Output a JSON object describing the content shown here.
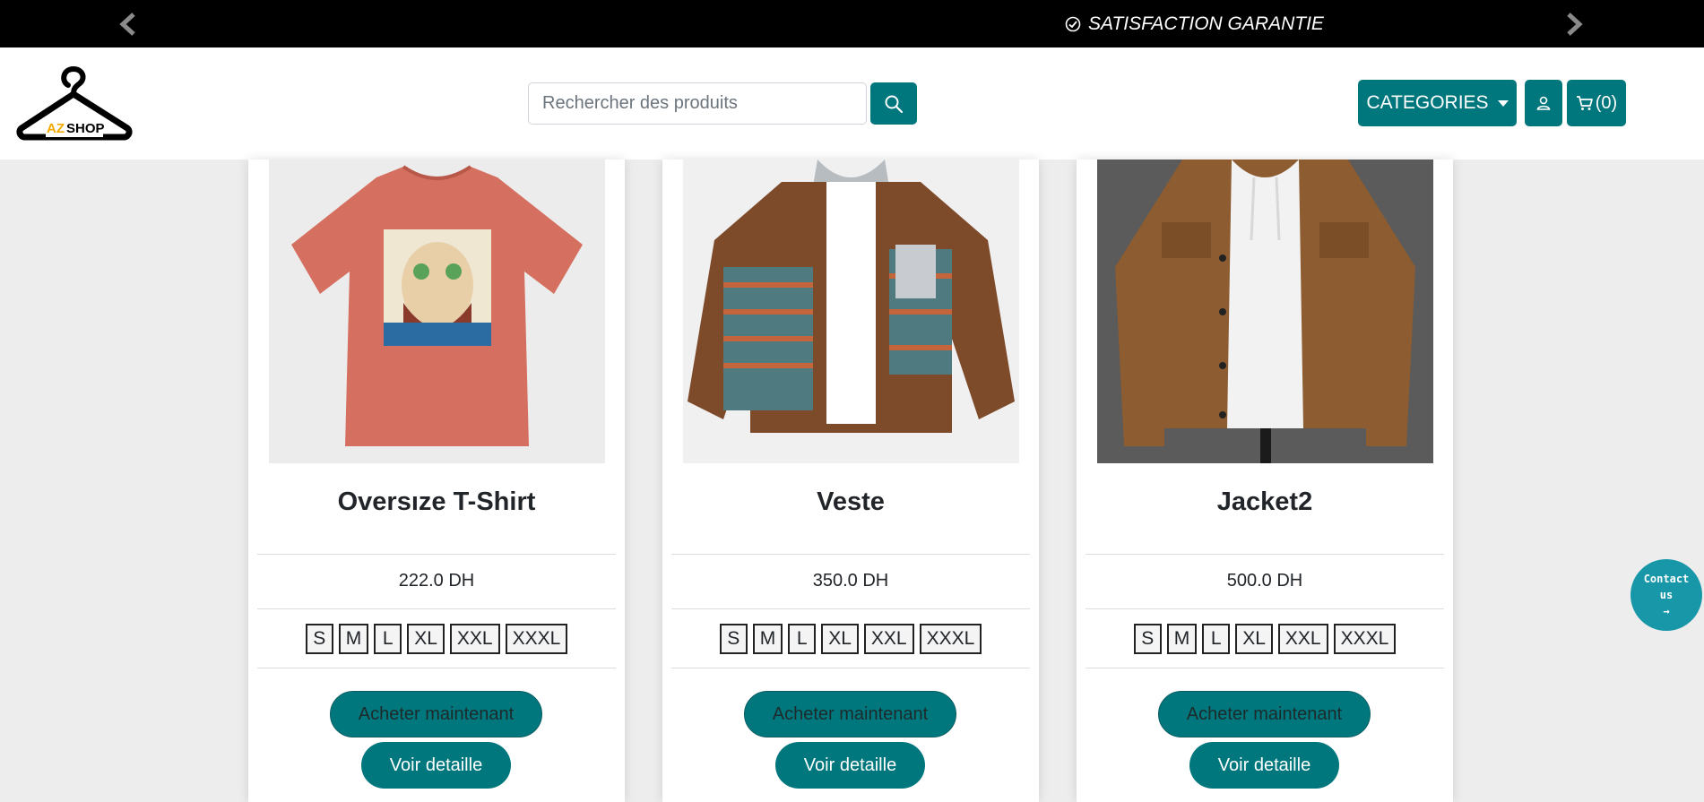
{
  "topbar": {
    "promo_text": "SATISFACTION GARANTIE",
    "icons": [
      "chevron-left-icon",
      "check-circle-icon",
      "chevron-right-icon"
    ]
  },
  "header": {
    "logo": {
      "brand": "AZ SHOP"
    },
    "search": {
      "placeholder": "Rechercher des produits",
      "value": ""
    },
    "categories_label": "CATEGORIES",
    "cart_label": "(0)",
    "icons": [
      "search-icon",
      "user-icon",
      "cart-icon",
      "caret-down-icon"
    ]
  },
  "products": [
    {
      "name": "Oversıze T-Shirt",
      "price": "222.0 DH",
      "sizes": [
        "S",
        "M",
        "L",
        "XL",
        "XXL",
        "XXXL"
      ],
      "buy_label": "Acheter maintenant",
      "details_label": "Voir detaille"
    },
    {
      "name": "Veste",
      "price": "350.0 DH",
      "sizes": [
        "S",
        "M",
        "L",
        "XL",
        "XXL",
        "XXXL"
      ],
      "buy_label": "Acheter maintenant",
      "details_label": "Voir detaille"
    },
    {
      "name": "Jacket2",
      "price": "500.0 DH",
      "sizes": [
        "S",
        "M",
        "L",
        "XL",
        "XXL",
        "XXXL"
      ],
      "buy_label": "Acheter maintenant",
      "details_label": "Voir detaille"
    }
  ],
  "contact": {
    "line1": "Contact",
    "line2": "us",
    "arrow": "→"
  },
  "colors": {
    "accent": "#00777d",
    "contact": "#1797a8",
    "topbar": "#000000"
  }
}
